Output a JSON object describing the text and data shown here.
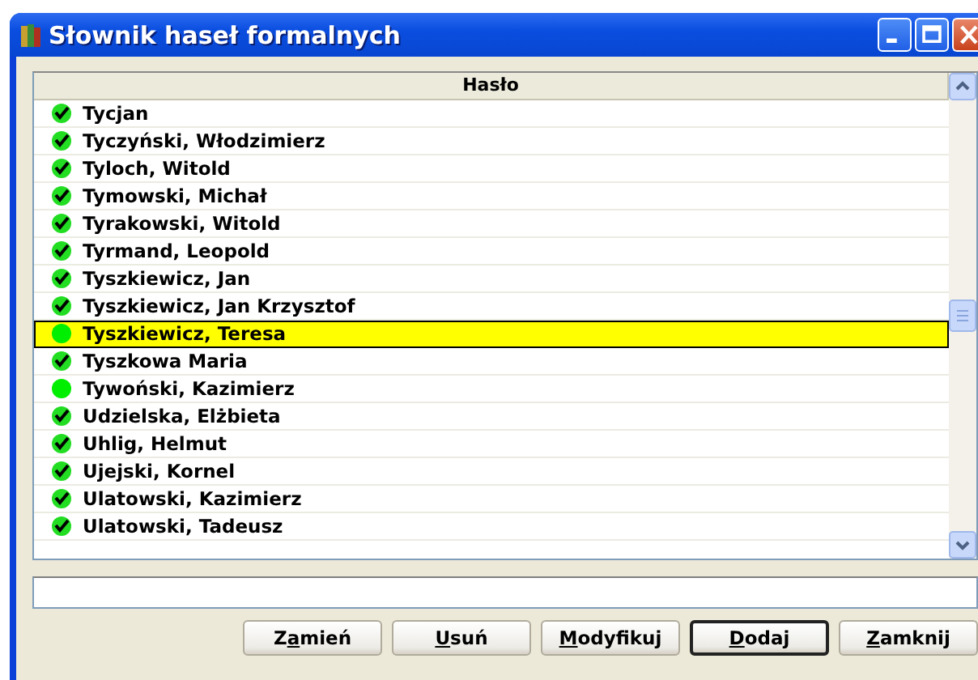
{
  "window": {
    "title": "Słownik haseł formalnych"
  },
  "table": {
    "columns": [
      "Hasło"
    ],
    "rows": [
      {
        "text": "Tycjan",
        "verified": true,
        "selected": false
      },
      {
        "text": "Tyczyński, Włodzimierz",
        "verified": true,
        "selected": false
      },
      {
        "text": "Tyloch, Witold",
        "verified": true,
        "selected": false
      },
      {
        "text": "Tymowski, Michał",
        "verified": true,
        "selected": false
      },
      {
        "text": "Tyrakowski, Witold",
        "verified": true,
        "selected": false
      },
      {
        "text": "Tyrmand, Leopold",
        "verified": true,
        "selected": false
      },
      {
        "text": "Tyszkiewicz, Jan",
        "verified": true,
        "selected": false
      },
      {
        "text": "Tyszkiewicz, Jan Krzysztof",
        "verified": true,
        "selected": false
      },
      {
        "text": "Tyszkiewicz, Teresa",
        "verified": false,
        "selected": true
      },
      {
        "text": "Tyszkowa Maria",
        "verified": true,
        "selected": false
      },
      {
        "text": "Tywoński, Kazimierz",
        "verified": false,
        "selected": false
      },
      {
        "text": "Udzielska, Elżbieta",
        "verified": true,
        "selected": false
      },
      {
        "text": "Uhlig, Helmut",
        "verified": true,
        "selected": false
      },
      {
        "text": "Ujejski, Kornel",
        "verified": true,
        "selected": false
      },
      {
        "text": "Ulatowski, Kazimierz",
        "verified": true,
        "selected": false
      },
      {
        "text": "Ulatowski, Tadeusz",
        "verified": true,
        "selected": false
      }
    ]
  },
  "buttons": [
    {
      "before": "Z",
      "key": "a",
      "after": "mień",
      "default": false
    },
    {
      "key": "U",
      "after": "suń",
      "default": false
    },
    {
      "key": "M",
      "after": "odyfikuj",
      "default": false
    },
    {
      "key": "D",
      "after": "odaj",
      "default": true
    },
    {
      "key": "Z",
      "after": "amknij",
      "default": false
    }
  ]
}
